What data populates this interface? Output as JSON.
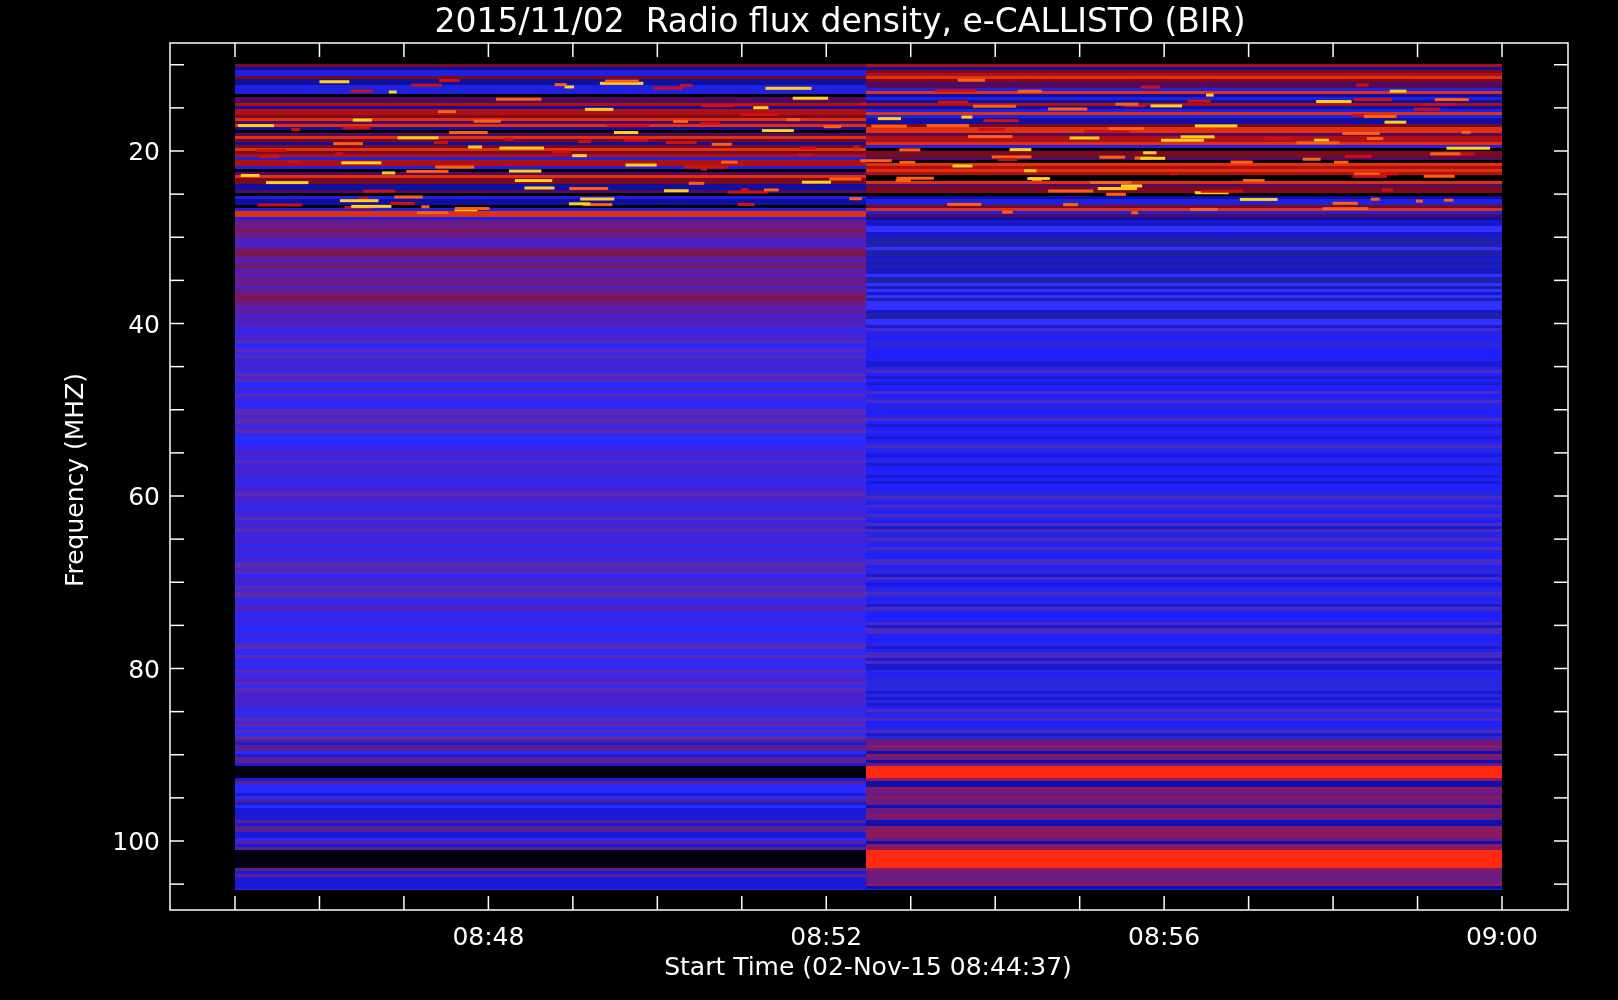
{
  "title": "2015/11/02  Radio flux density, e-CALLISTO (BIR)",
  "plot": {
    "ylabel": "Frequency (MHZ)",
    "xlabel": "Start Time (02-Nov-15 08:44:37)",
    "yticks": [
      {
        "label": "20"
      },
      {
        "label": "40"
      },
      {
        "label": "60"
      },
      {
        "label": "80"
      },
      {
        "label": "100"
      }
    ],
    "xticks": [
      {
        "label": "08:48"
      },
      {
        "label": "08:52"
      },
      {
        "label": "08:56"
      },
      {
        "label": "09:00"
      }
    ]
  }
}
